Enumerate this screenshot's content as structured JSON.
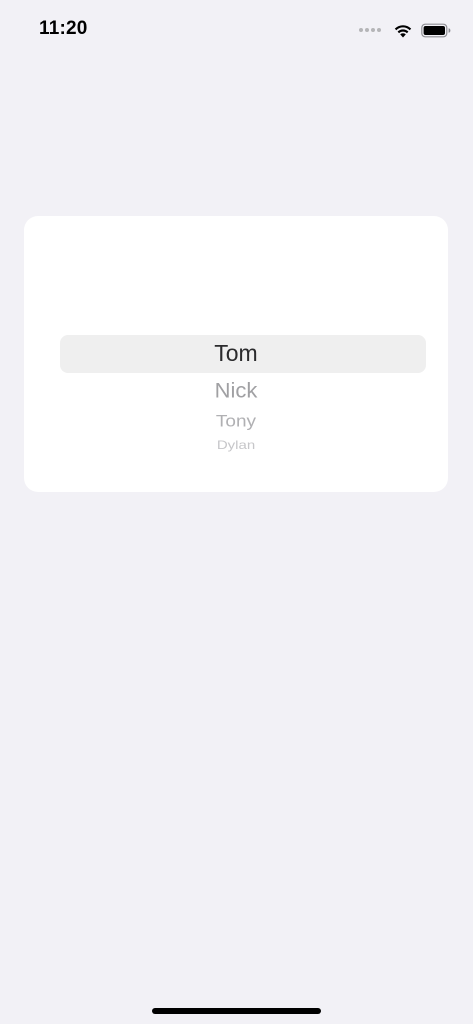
{
  "status_bar": {
    "time": "11:20",
    "icons": [
      "cellular-signal-icon",
      "wifi-icon",
      "battery-icon"
    ]
  },
  "picker": {
    "selected": "Tom",
    "options": [
      "Tom",
      "Nick",
      "Tony",
      "Dylan"
    ]
  },
  "colors": {
    "background": "#f2f1f6",
    "card": "#ffffff",
    "selection_highlight": "#efefef"
  }
}
